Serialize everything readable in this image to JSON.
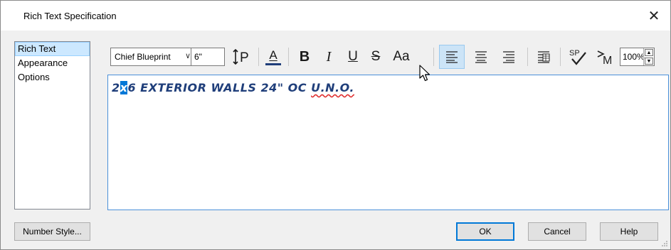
{
  "window": {
    "title": "Rich Text Specification",
    "close_label": "✕"
  },
  "sidebar": {
    "items": [
      {
        "label": "Rich Text",
        "selected": true
      },
      {
        "label": "Appearance",
        "selected": false
      },
      {
        "label": "Options",
        "selected": false
      }
    ]
  },
  "toolbar": {
    "font_name": "Chief Blueprint",
    "font_size": "6\"",
    "line_spacing_icon": "line-spacing-icon",
    "text_color_label": "A",
    "bold_label": "B",
    "italic_label": "I",
    "underline_label": "U",
    "strike_label": "S",
    "case_label": "Aa",
    "align_left_active": true,
    "zoom": "100%",
    "accent_color": "#0078d7",
    "text_color": "#1f3e7a"
  },
  "editor": {
    "text_before": "2",
    "text_selected": "x",
    "text_middle": "6 EXTERIOR WALLS 24\" OC ",
    "text_misspelled": "U.N.O."
  },
  "buttons": {
    "number_style": "Number Style...",
    "ok": "OK",
    "cancel": "Cancel",
    "help": "Help"
  }
}
